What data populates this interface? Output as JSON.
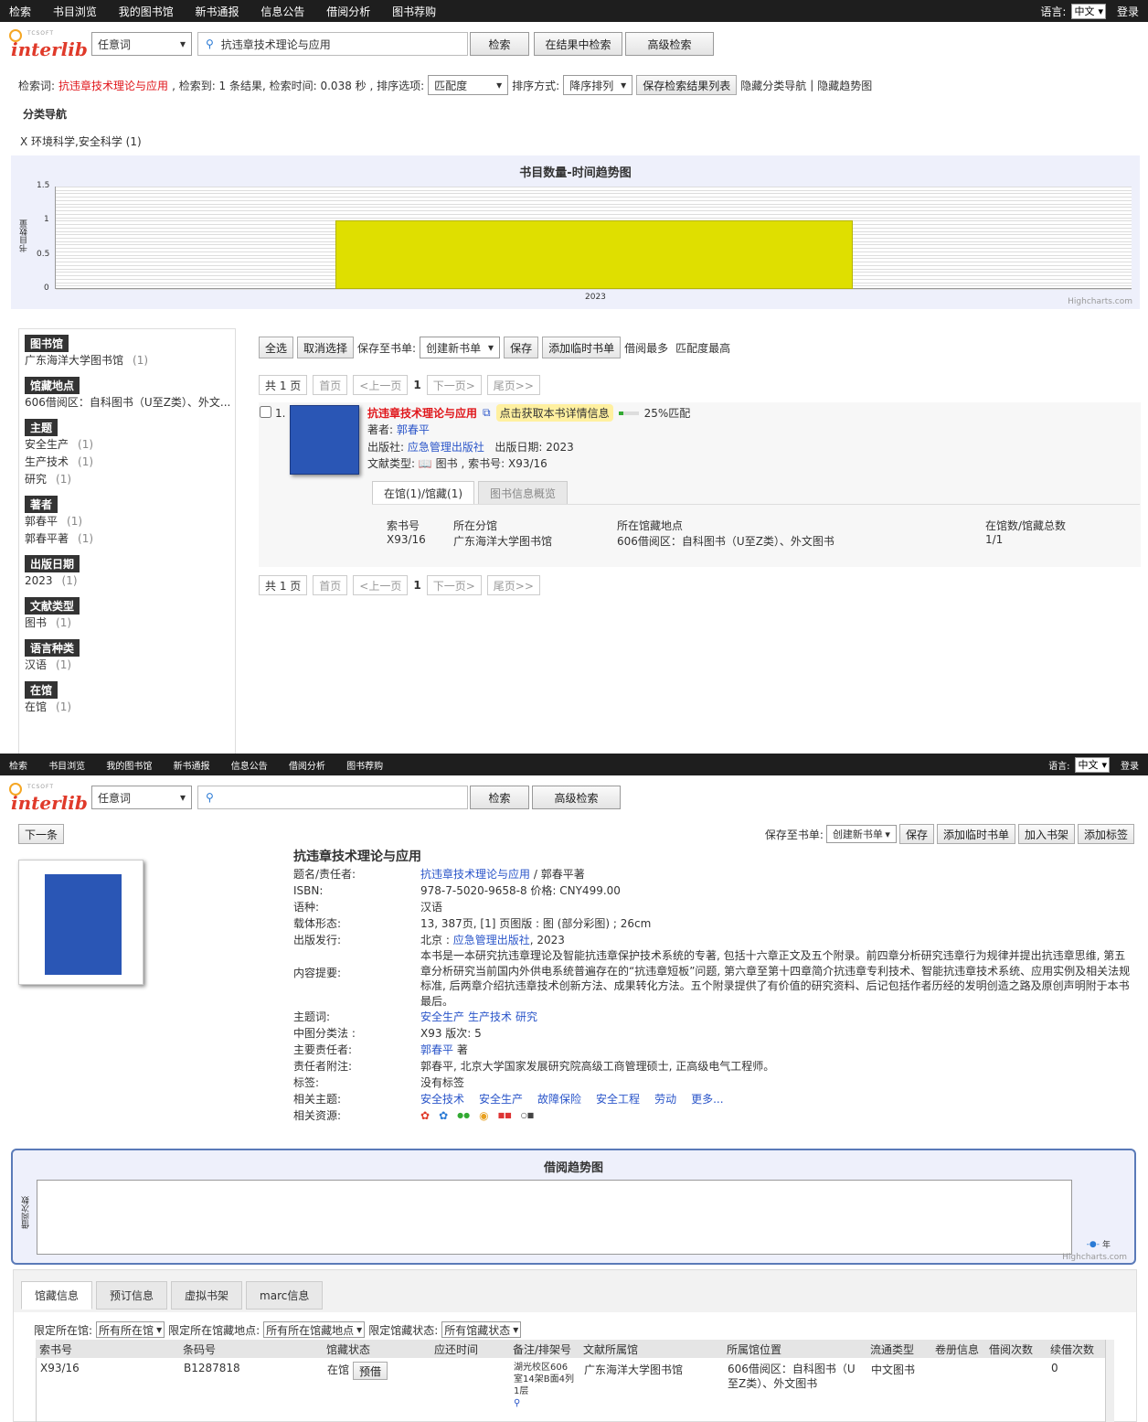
{
  "nav": [
    "检索",
    "书目浏览",
    "我的图书馆",
    "新书通报",
    "信息公告",
    "借阅分析",
    "图书荐购"
  ],
  "lang_label": "语言:",
  "lang_value": "中文",
  "login": "登录",
  "logo_small": "TCSOFT",
  "logo_big": "interlib",
  "search": {
    "field": "任意词",
    "query": "抗违章技术理论与应用",
    "btn_search": "检索",
    "btn_in_result": "在结果中检索",
    "btn_advanced": "高级检索"
  },
  "result_info": {
    "label_term": "检索词:",
    "term": "抗违章技术理论与应用",
    "found": ", 检索到: 1 条结果, 检索时间: 0.038 秒 , 排序选项:",
    "sort_option": "匹配度",
    "sort_method_label": "排序方式:",
    "sort_method": "降序排列",
    "save_btn": "保存检索结果列表",
    "hide_cat": "隐藏分类导航",
    "sep": "|",
    "hide_trend": "隐藏趋势图"
  },
  "catnav": {
    "title": "分类导航",
    "item": "X 环境科学,安全科学 (1)"
  },
  "chart_data": {
    "type": "bar",
    "title": "书目数量-时间趋势图",
    "ylabel": "书目数量",
    "categories": [
      "2023"
    ],
    "values": [
      1
    ],
    "ylim": [
      0,
      1.5
    ],
    "yticks": [
      "1.5",
      "1",
      "0.5",
      "0"
    ],
    "credit": "Highcharts.com"
  },
  "facets": [
    {
      "h": "图书馆",
      "items": [
        [
          "广东海洋大学图书馆",
          "(1)"
        ]
      ]
    },
    {
      "h": "馆藏地点",
      "items": [
        [
          "606借阅区：自科图书（U至Z类）、外文...",
          ""
        ]
      ]
    },
    {
      "h": "主题",
      "items": [
        [
          "安全生产",
          "(1)"
        ],
        [
          "生产技术",
          "(1)"
        ],
        [
          "研究",
          "(1)"
        ]
      ]
    },
    {
      "h": "著者",
      "items": [
        [
          "郭春平",
          "(1)"
        ],
        [
          "郭春平著",
          "(1)"
        ]
      ]
    },
    {
      "h": "出版日期",
      "items": [
        [
          "2023",
          "(1)"
        ]
      ]
    },
    {
      "h": "文献类型",
      "items": [
        [
          "图书",
          "(1)"
        ]
      ]
    },
    {
      "h": "语言种类",
      "items": [
        [
          "汉语",
          "(1)"
        ]
      ]
    },
    {
      "h": "在馆",
      "items": [
        [
          "在馆",
          "(1)"
        ]
      ]
    }
  ],
  "toolbar": {
    "select_all": "全选",
    "cancel_sel": "取消选择",
    "save_to": "保存至书单:",
    "new_list": "创建新书单",
    "save": "保存",
    "add_temp": "添加临时书单",
    "most_borrowed": "借阅最多",
    "best_match": "匹配度最高"
  },
  "pager": {
    "total": "共 1 页",
    "first": "首页",
    "prev": "<上一页",
    "cur": "1",
    "next": "下一页>",
    "last": "尾页>>"
  },
  "book": {
    "num": "1.",
    "title": "抗违章技术理论与应用",
    "get_detail": "点击获取本书详情信息",
    "match": "25%匹配",
    "author_label": "著者:",
    "author": "郭春平",
    "publisher_label": "出版社:",
    "publisher": "应急管理出版社",
    "pubdate_label": "出版日期:",
    "pubdate": "2023",
    "type_label": "文献类型:",
    "type": "图书",
    "callno_label": "索书号:",
    "callno": "X93/16",
    "tab1": "在馆(1)/馆藏(1)",
    "tab2": "图书信息概览",
    "h_callno": "索书号",
    "h_lib": "所在分馆",
    "h_loc": "所在馆藏地点",
    "h_count": "在馆数/馆藏总数",
    "v_callno": "X93/16",
    "v_lib": "广东海洋大学图书馆",
    "v_loc": "606借阅区：自科图书（U至Z类）、外文图书",
    "v_count": "1/1"
  },
  "detail": {
    "next": "下一条",
    "save_to": "保存至书单:",
    "new_list": "创建新书单",
    "save": "保存",
    "add_temp": "添加临时书单",
    "add_shelf": "加入书架",
    "add_tag": "添加标签",
    "title": "抗违章技术理论与应用",
    "rows": [
      {
        "k": "题名/责任者:",
        "link": "抗违章技术理论与应用",
        "v": " / 郭春平著"
      },
      {
        "k": "ISBN:",
        "v": "978-7-5020-9658-8 价格:  CNY499.00"
      },
      {
        "k": "语种:",
        "v": "汉语"
      },
      {
        "k": "载体形态:",
        "v": "13, 387页, [1] 页图版 : 图 (部分彩图) ; 26cm"
      },
      {
        "k": "出版发行:",
        "pre": "北京 : ",
        "link": "应急管理出版社",
        "v": ", 2023"
      }
    ],
    "abstract_label": "内容提要:",
    "abstract": "本书是一本研究抗违章理论及智能抗违章保护技术系统的专著, 包括十六章正文及五个附录。前四章分析研究违章行为规律并提出抗违章思维, 第五章分析研究当前国内外供电系统普遍存在的“抗违章短板”问题, 第六章至第十四章简介抗违章专利技术、智能抗违章技术系统、应用实例及相关法规标准, 后两章介绍抗违章技术创新方法、成果转化方法。五个附录提供了有价值的研究资料、后记包括作者历经的发明创造之路及原创声明附于本书最后。",
    "rows2": [
      {
        "k": "主题词:",
        "links": [
          "安全生产",
          "生产技术",
          "研究"
        ]
      },
      {
        "k": "中图分类法 :",
        "v": "X93 版次:   5"
      },
      {
        "k": "主要责任者:",
        "link": "郭春平",
        "v": " 著"
      },
      {
        "k": "责任者附注:",
        "v": "郭春平, 北京大学国家发展研究院高级工商管理硕士, 正高级电气工程师。"
      },
      {
        "k": "标签:",
        "v": "没有标签"
      },
      {
        "k": "相关主题:",
        "links": [
          "安全技术",
          "安全生产",
          "故障保险",
          "安全工程",
          "劳动",
          "更多..."
        ]
      }
    ],
    "res_label": "相关资源:"
  },
  "borrow_chart": {
    "title": "借阅趋势图",
    "ylabel": "借阅次数",
    "legend": "年",
    "credit": "Highcharts.com"
  },
  "holdings": {
    "tabs": [
      "馆藏信息",
      "预订信息",
      "虚拟书架",
      "marc信息"
    ],
    "f1_label": "限定所在馆:",
    "f1": "所有所在馆",
    "f2_label": "限定所在馆藏地点:",
    "f2": "所有所在馆藏地点",
    "f3_label": "限定馆藏状态:",
    "f3": "所有馆藏状态",
    "cols": [
      "索书号",
      "条码号",
      "馆藏状态",
      "应还时间",
      "备注/排架号",
      "文献所属馆",
      "所属馆位置",
      "流通类型",
      "卷册信息",
      "借阅次数",
      "续借次数"
    ],
    "row": {
      "callno": "X93/16",
      "barcode": "B1287818",
      "status": "在馆",
      "reserve": "预借",
      "due": "",
      "shelf": "湖光校区606室14架B面4列1层",
      "lib": "广东海洋大学图书馆",
      "loc": "606借阅区：自科图书（U至Z类）、外文图书",
      "circ": "中文图书",
      "vol": "",
      "borrow": "",
      "renew": "0"
    }
  },
  "colors": {
    "bar": "#dfdf00",
    "topbar": "#1e1e1e",
    "link": "#2a55c9",
    "red": "#e0161b"
  }
}
